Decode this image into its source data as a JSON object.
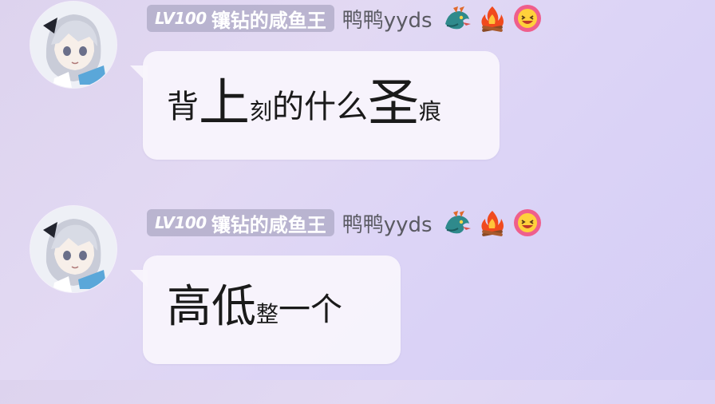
{
  "messages": [
    {
      "badge": {
        "level": "LV100",
        "title": "镶钻的咸鱼王"
      },
      "nickname": "鸭鸭yyds",
      "decorations": [
        "dragon-icon",
        "campfire-icon",
        "laughing-face-icon"
      ],
      "text_parts": [
        {
          "text": "背",
          "size": "m"
        },
        {
          "text": "上",
          "size": "xl"
        },
        {
          "text": "刻",
          "size": "s"
        },
        {
          "text": "的什么",
          "size": "m"
        },
        {
          "text": "圣",
          "size": "xl"
        },
        {
          "text": "痕",
          "size": "s"
        }
      ]
    },
    {
      "badge": {
        "level": "LV100",
        "title": "镶钻的咸鱼王"
      },
      "nickname": "鸭鸭yyds",
      "decorations": [
        "dragon-icon",
        "campfire-icon",
        "laughing-face-icon"
      ],
      "text_parts": [
        {
          "text": "高低",
          "size": "l"
        },
        {
          "text": "整",
          "size": "s"
        },
        {
          "text": "一个",
          "size": "m"
        }
      ]
    }
  ]
}
